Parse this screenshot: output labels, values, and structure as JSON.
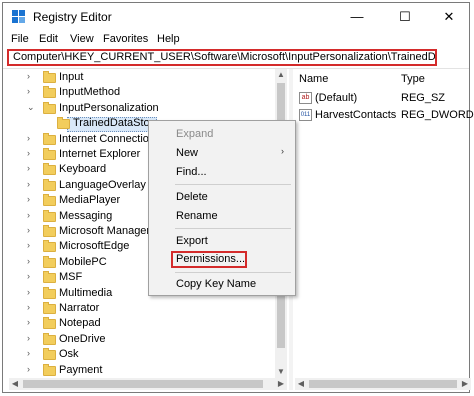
{
  "window": {
    "title": "Registry Editor",
    "minimize_glyph": "—",
    "maximize_glyph": "☐",
    "close_glyph": "✕"
  },
  "menu": [
    "File",
    "Edit",
    "View",
    "Favorites",
    "Help"
  ],
  "address": "Computer\\HKEY_CURRENT_USER\\Software\\Microsoft\\InputPersonalization\\TrainedDataStore",
  "tree": {
    "expanded_chevron": "⌄",
    "collapsed_chevron": "›",
    "items": [
      {
        "label": "Input",
        "chevron": "collapsed"
      },
      {
        "label": "InputMethod",
        "chevron": "collapsed"
      },
      {
        "label": "InputPersonalization",
        "chevron": "expanded"
      },
      {
        "label": "TrainedDataStor",
        "selected": true
      },
      {
        "label": "Internet Connection",
        "chevron": "collapsed"
      },
      {
        "label": "Internet Explorer",
        "chevron": "collapsed"
      },
      {
        "label": "Keyboard",
        "chevron": "collapsed"
      },
      {
        "label": "LanguageOverlay",
        "chevron": "collapsed"
      },
      {
        "label": "MediaPlayer",
        "chevron": "collapsed"
      },
      {
        "label": "Messaging",
        "chevron": "collapsed"
      },
      {
        "label": "Microsoft Manager",
        "chevron": "collapsed"
      },
      {
        "label": "MicrosoftEdge",
        "chevron": "collapsed"
      },
      {
        "label": "MobilePC",
        "chevron": "collapsed"
      },
      {
        "label": "MSF",
        "chevron": "collapsed"
      },
      {
        "label": "Multimedia",
        "chevron": "collapsed"
      },
      {
        "label": "Narrator",
        "chevron": "collapsed"
      },
      {
        "label": "Notepad",
        "chevron": "collapsed"
      },
      {
        "label": "OneDrive",
        "chevron": "collapsed"
      },
      {
        "label": "Osk",
        "chevron": "collapsed"
      },
      {
        "label": "Payment",
        "chevron": "collapsed"
      }
    ]
  },
  "list": {
    "columns": [
      "Name",
      "Type"
    ],
    "rows": [
      {
        "name": "(Default)",
        "type": "REG_SZ",
        "icon": "string-value-icon",
        "icon_text": "ab"
      },
      {
        "name": "HarvestContacts",
        "type": "REG_DWORD",
        "icon": "binary-value-icon",
        "icon_text": "011"
      }
    ]
  },
  "context_menu": {
    "items": [
      {
        "label": "Expand",
        "disabled": true
      },
      {
        "label": "New",
        "submenu": true
      },
      {
        "label": "Find..."
      },
      {
        "label": "Delete"
      },
      {
        "label": "Rename"
      },
      {
        "label": "Export"
      },
      {
        "label": "Permissions...",
        "highlighted": true
      },
      {
        "label": "Copy Key Name"
      }
    ],
    "submenu_arrow": "›"
  },
  "scroll": {
    "up": "▲",
    "down": "▼",
    "left": "◀",
    "right": "▶"
  },
  "colors": {
    "highlight_box": "#d42b2b",
    "folder": "#f2cd5c",
    "selection": "#d9e8f8"
  }
}
